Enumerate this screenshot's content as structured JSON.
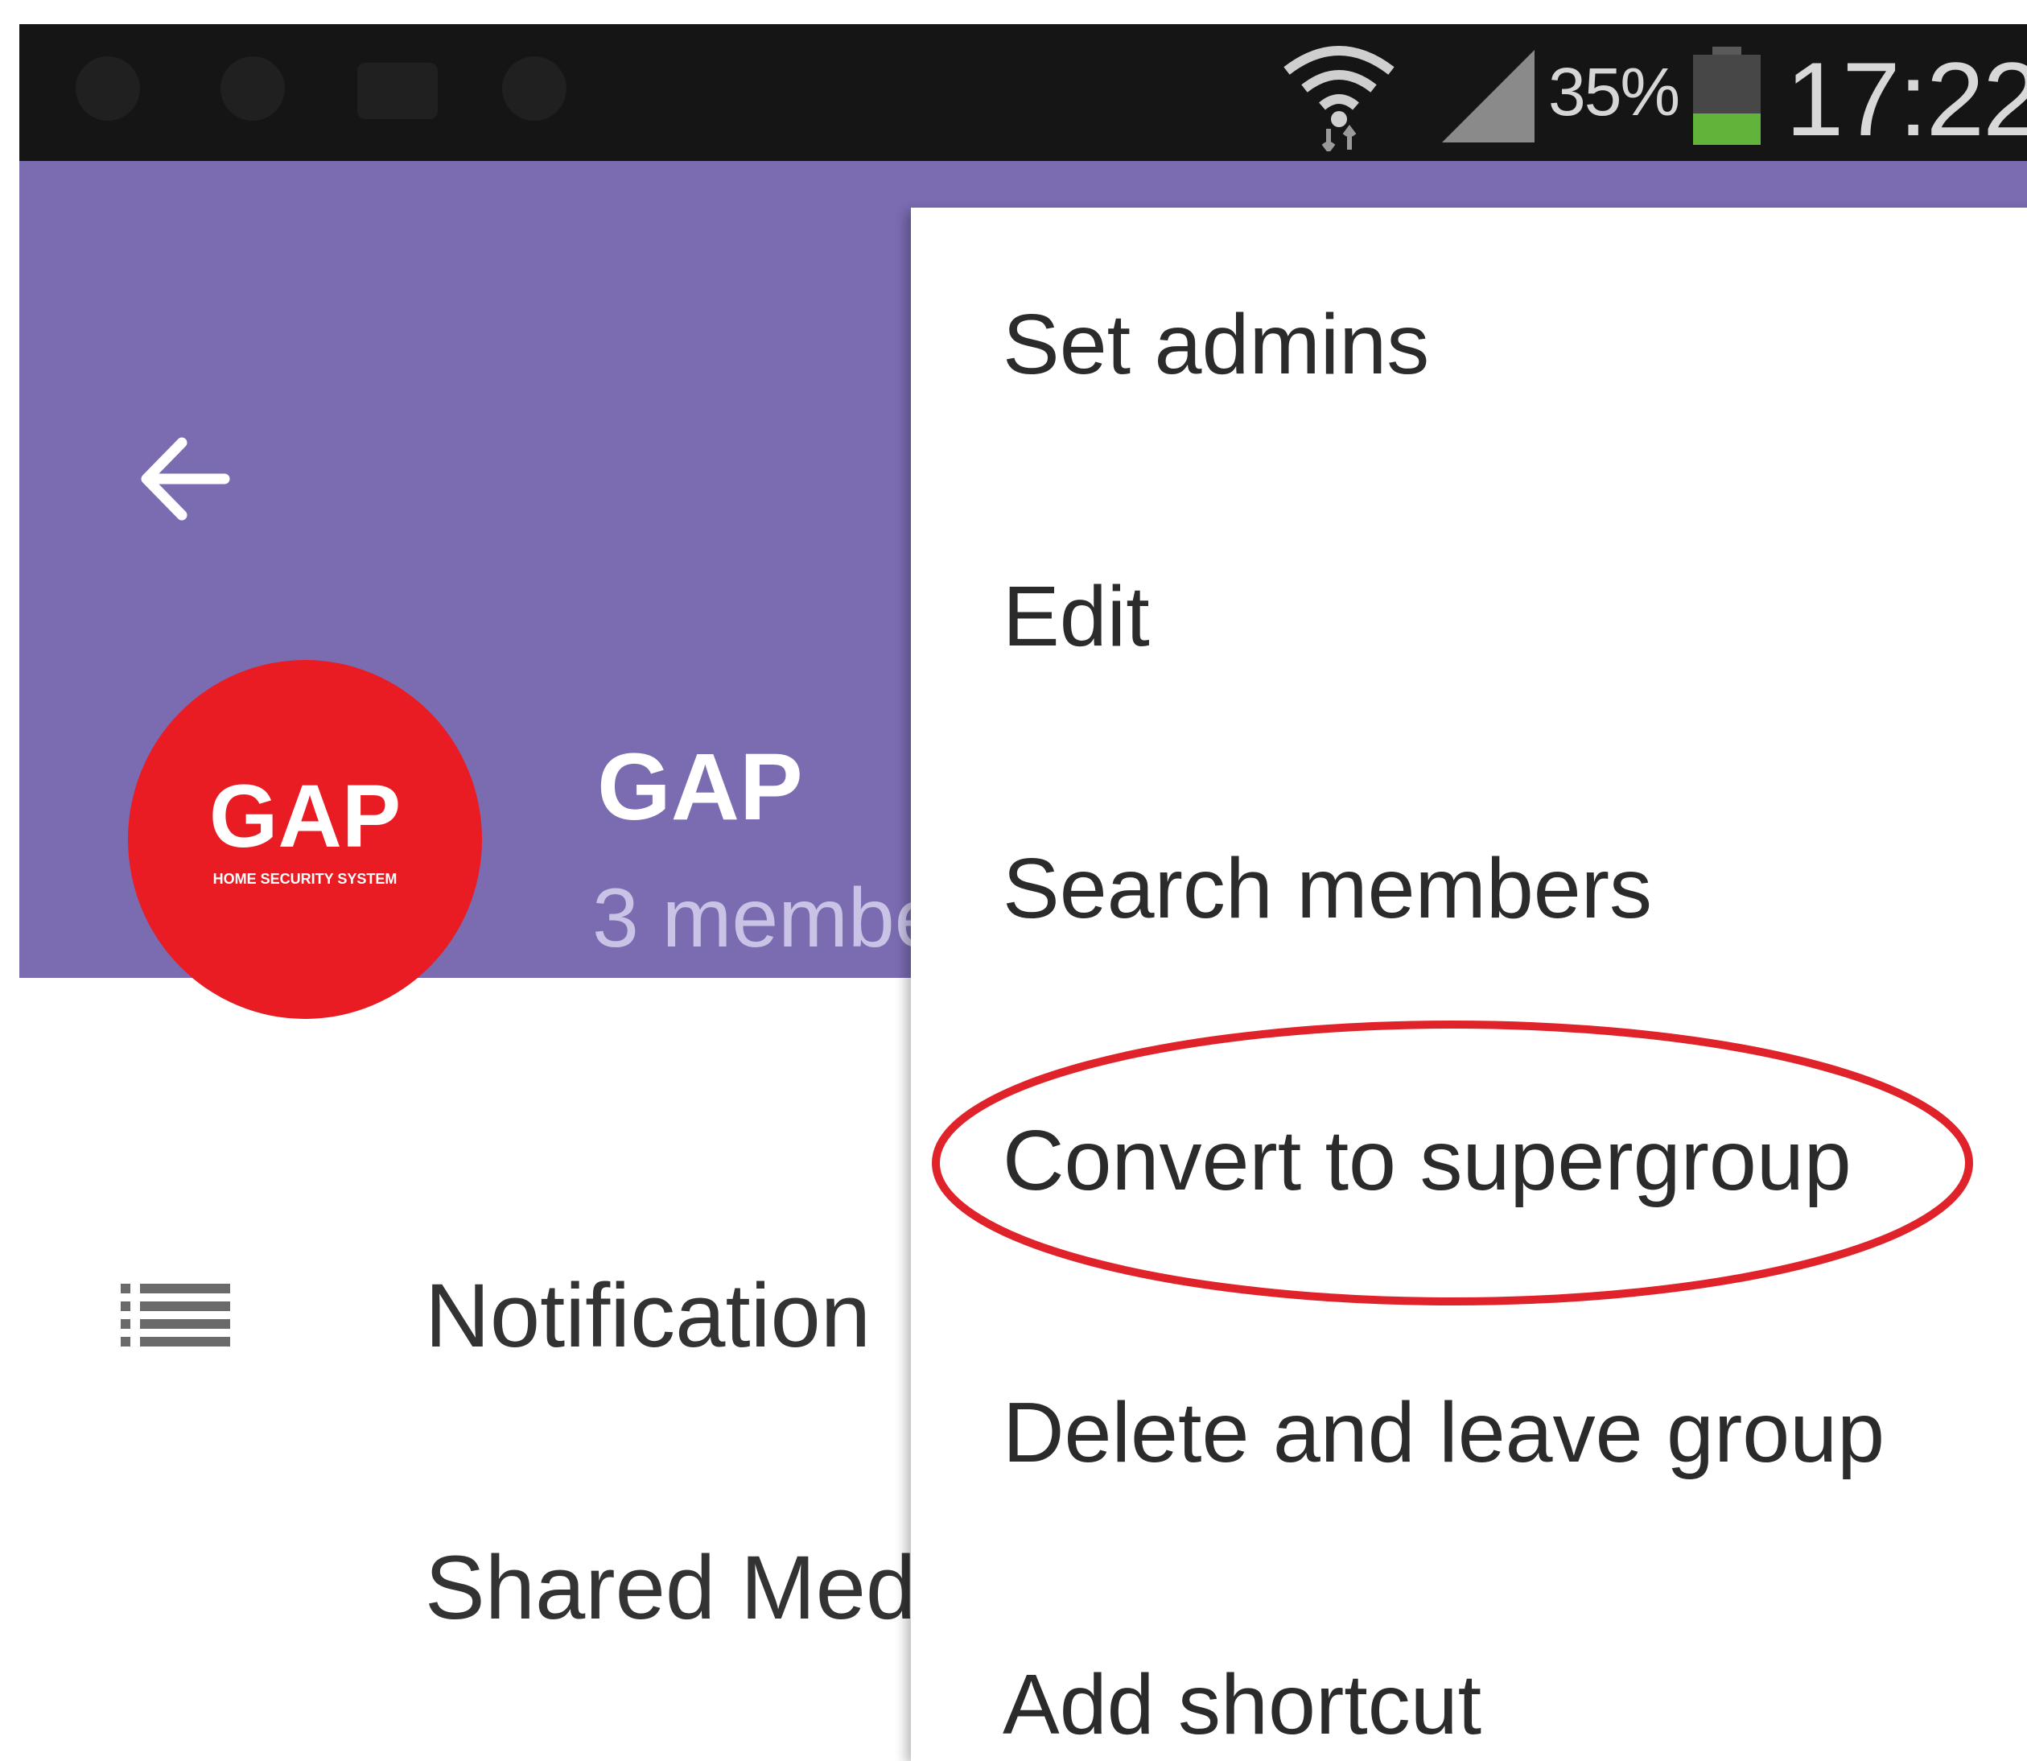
{
  "status_bar": {
    "battery_percent": "35%",
    "battery_level": 0.35,
    "time": "17:22",
    "icons": [
      "wifi-icon",
      "signal-icon",
      "battery-icon"
    ]
  },
  "group": {
    "avatar_logo_text": "GAP",
    "avatar_tagline": "HOME SECURITY SYSTEM",
    "name": "GAP",
    "members": "3 membe"
  },
  "settings_rows": [
    {
      "label": "Notification",
      "icon": "list-icon"
    },
    {
      "label": "Shared Med"
    }
  ],
  "menu": {
    "items": [
      {
        "label": "Set admins"
      },
      {
        "label": "Edit"
      },
      {
        "label": "Search members"
      },
      {
        "label": "Convert to supergroup",
        "highlighted": true
      },
      {
        "label": "Delete and leave group"
      },
      {
        "label": "Add shortcut"
      }
    ]
  },
  "colors": {
    "header": "#7b6cb2",
    "avatar": "#e91c24",
    "highlight": "#e0232b",
    "battery": "#62b33a"
  }
}
